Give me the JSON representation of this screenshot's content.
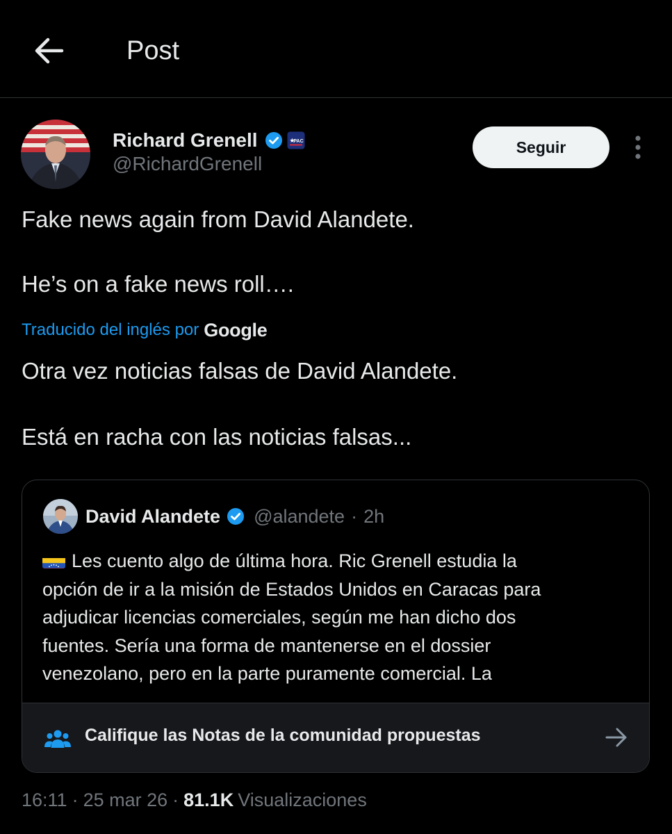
{
  "header": {
    "title": "Post"
  },
  "author": {
    "name": "Richard Grenell",
    "handle": "@RichardGrenell",
    "badge_text": "PAC"
  },
  "actions": {
    "follow_label": "Seguir"
  },
  "tweet": {
    "lines": [
      "Fake news again from David Alandete.",
      "He’s on a fake news roll…."
    ],
    "translation_label": "Traducido del inglés por",
    "translation_provider": "Google",
    "translated_lines": [
      "Otra vez noticias falsas de David Alandete.",
      "Está en racha con las noticias falsas..."
    ]
  },
  "quote": {
    "name": "David Alandete",
    "handle": "@alandete",
    "separator": "·",
    "time": "2h",
    "flag_icon": "venezuela-flag",
    "lines": [
      "Les cuento algo de última hora. Ric Grenell estudia la",
      "opción de ir a la misión de Estados Unidos en Caracas para",
      "adjudicar licencias comerciales, según me han dicho dos",
      "fuentes. Sería una forma de mantenerse en el dossier",
      "venezolano, pero en la parte puramente comercial. La"
    ],
    "community_notes_label": "Califique las Notas de la comunidad propuestas"
  },
  "meta": {
    "time": "16:11",
    "sep1": "·",
    "date": "25 mar 26",
    "sep2": "·",
    "views_count": "81.1K",
    "views_label": "Visualizaciones"
  },
  "colors": {
    "background": "#000000",
    "accent": "#1d9bf0",
    "text_primary": "#e7e9ea",
    "text_secondary": "#71767b",
    "border": "#2f3336"
  }
}
